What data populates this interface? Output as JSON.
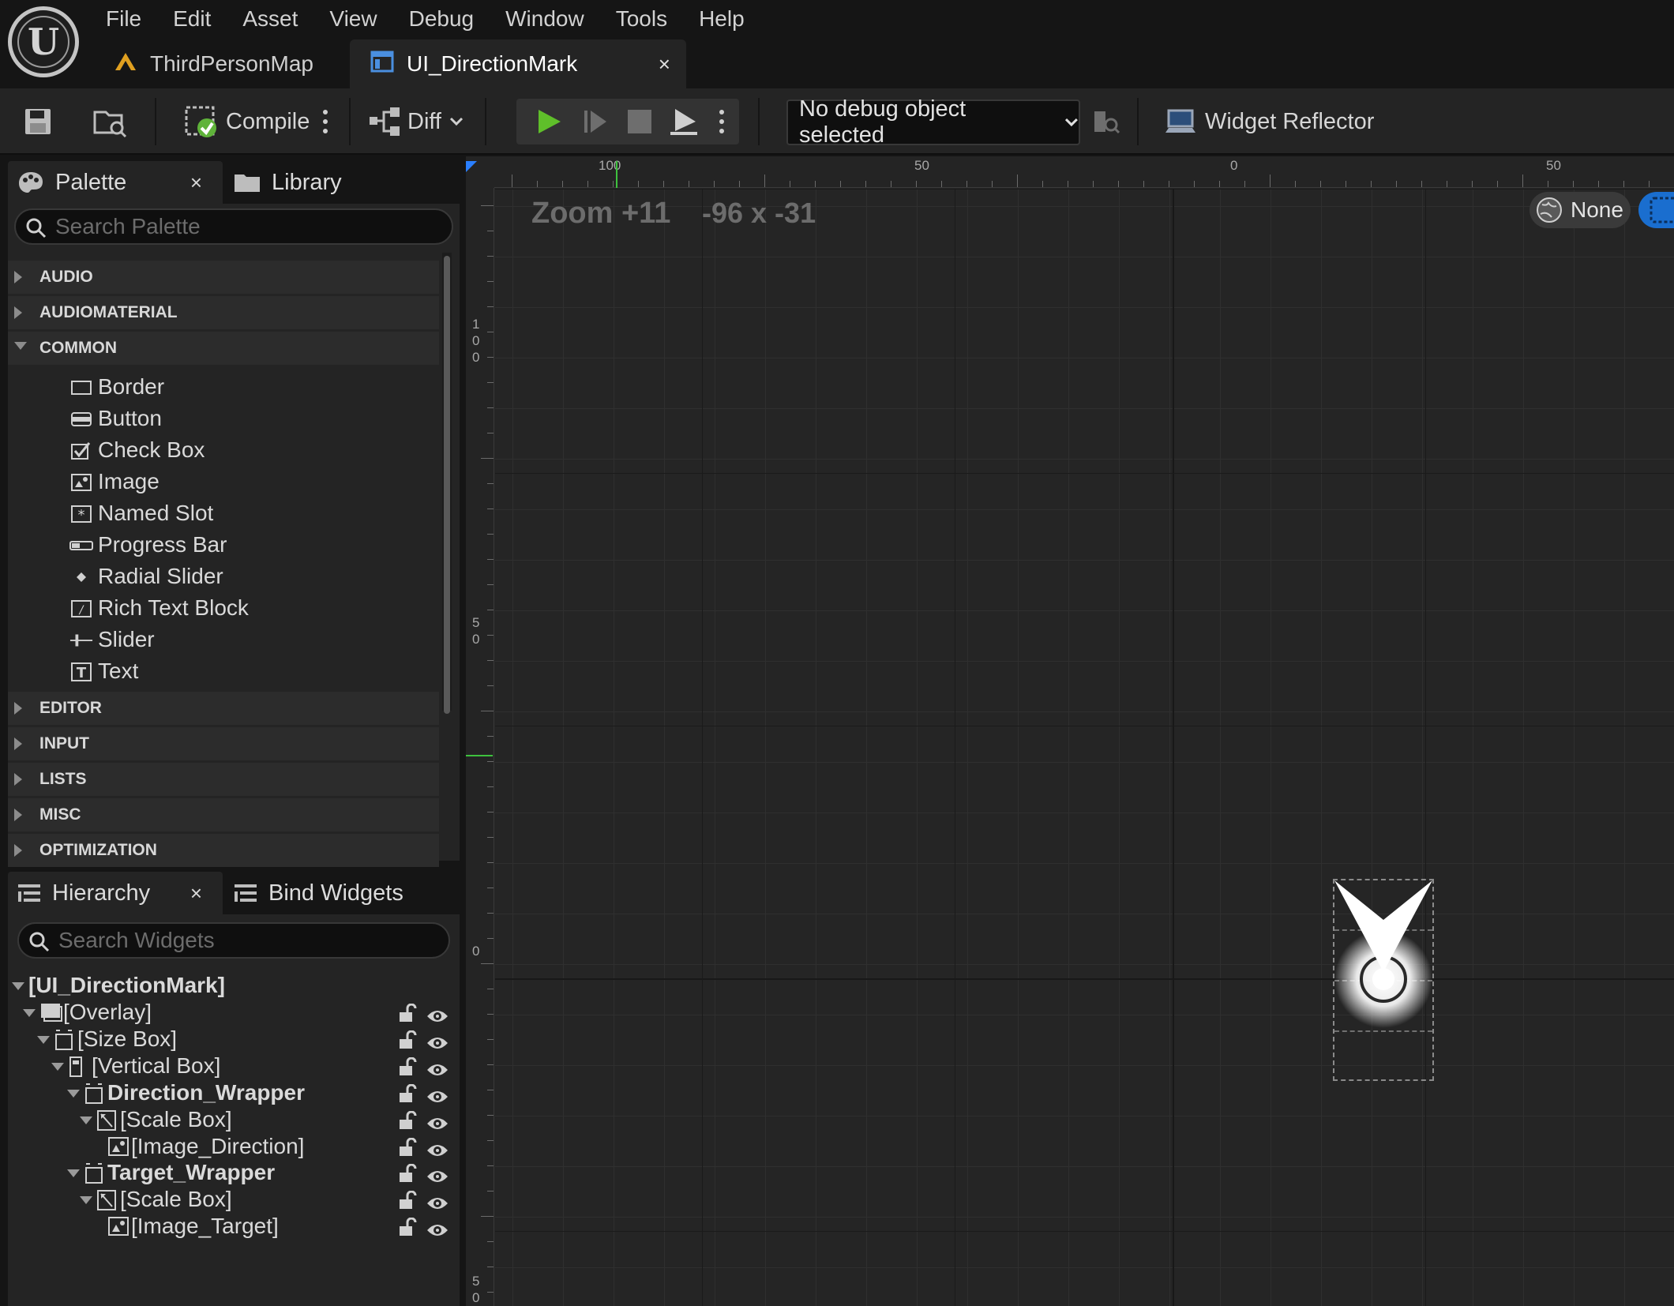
{
  "menu": [
    "File",
    "Edit",
    "Asset",
    "View",
    "Debug",
    "Window",
    "Tools",
    "Help"
  ],
  "tabs": {
    "map": "ThirdPersonMap",
    "widget": "UI_DirectionMark",
    "close": "×"
  },
  "toolbar": {
    "compile": "Compile",
    "diff": "Diff",
    "debug_object": "No debug object selected",
    "widget_reflector": "Widget Reflector"
  },
  "palette": {
    "tab_label": "Palette",
    "close": "×",
    "library_label": "Library",
    "search_placeholder": "Search Palette",
    "categories_top": [
      "AUDIO",
      "AUDIOMATERIAL",
      "COMMON"
    ],
    "common_items": [
      "Border",
      "Button",
      "Check Box",
      "Image",
      "Named Slot",
      "Progress Bar",
      "Radial Slider",
      "Rich Text Block",
      "Slider",
      "Text"
    ],
    "categories_bottom": [
      "EDITOR",
      "INPUT",
      "LISTS",
      "MISC",
      "OPTIMIZATION"
    ]
  },
  "hierarchy": {
    "tab_label": "Hierarchy",
    "close": "×",
    "bind_label": "Bind Widgets",
    "search_placeholder": "Search Widgets",
    "root": "[UI_DirectionMark]",
    "nodes": [
      "[Overlay]",
      "[Size Box]",
      "[Vertical Box]",
      "Direction_Wrapper",
      "[Scale Box]",
      "[Image_Direction]",
      "Target_Wrapper",
      "[Scale Box]",
      "[Image_Target]"
    ]
  },
  "designer": {
    "zoom": "Zoom +11",
    "coords": "-96 x -31",
    "dpi_label": "None",
    "ruler_top": [
      "100",
      "50",
      "0",
      "50"
    ],
    "ruler_left": [
      "1\n0\n0",
      "5\n0",
      "0",
      "5\n0"
    ]
  }
}
